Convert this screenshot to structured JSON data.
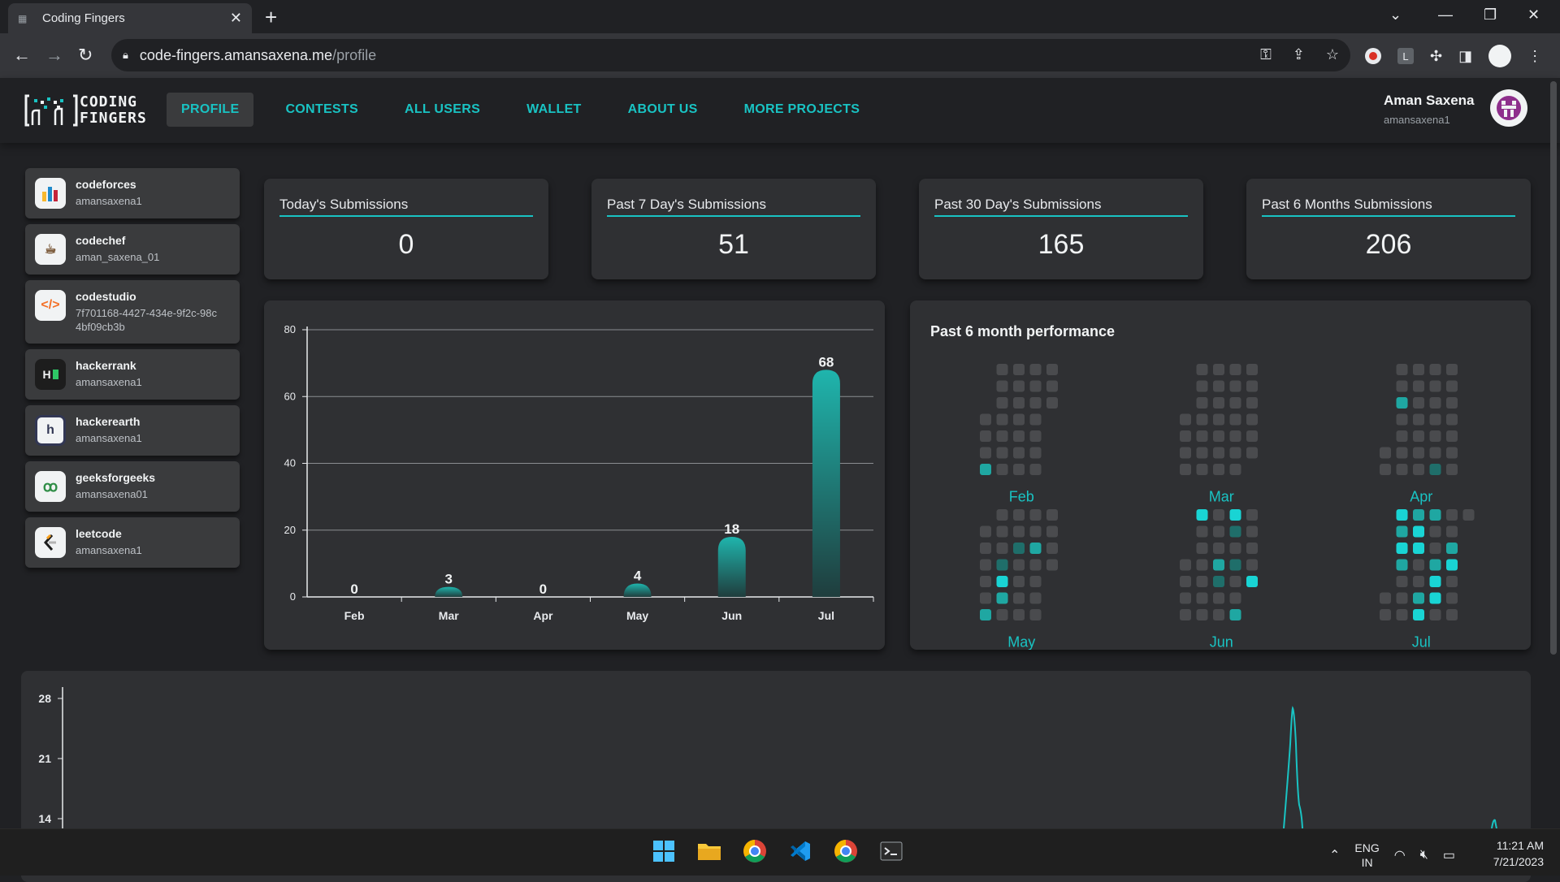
{
  "browser": {
    "tab_title": "Coding Fingers",
    "url_host": "code-fingers.amansaxena.me",
    "url_path": "/profile"
  },
  "site": {
    "logo_line1": "CODING",
    "logo_line2": "FINGERS",
    "nav": [
      "PROFILE",
      "CONTESTS",
      "ALL USERS",
      "WALLET",
      "ABOUT US",
      "MORE PROJECTS"
    ],
    "active_nav": "PROFILE",
    "user_name": "Aman Saxena",
    "user_handle": "amansaxena1"
  },
  "platforms": [
    {
      "name": "codeforces",
      "user": "amansaxena1",
      "icon": "codeforces-icon"
    },
    {
      "name": "codechef",
      "user": "aman_saxena_01",
      "icon": "codechef-icon"
    },
    {
      "name": "codestudio",
      "user": "7f701168-4427-434e-9f2c-98c4bf09cb3b",
      "icon": "codestudio-icon"
    },
    {
      "name": "hackerrank",
      "user": "amansaxena1",
      "icon": "hackerrank-icon"
    },
    {
      "name": "hackerearth",
      "user": "amansaxena1",
      "icon": "hackerearth-icon"
    },
    {
      "name": "geeksforgeeks",
      "user": "amansaxena01",
      "icon": "geeksforgeeks-icon"
    },
    {
      "name": "leetcode",
      "user": "amansaxena1",
      "icon": "leetcode-icon"
    }
  ],
  "stats": [
    {
      "title": "Today's Submissions",
      "value": "0"
    },
    {
      "title": "Past 7 Day's Submissions",
      "value": "51"
    },
    {
      "title": "Past 30 Day's Submissions",
      "value": "165"
    },
    {
      "title": "Past 6 Months Submissions",
      "value": "206"
    }
  ],
  "perf_title": "Past 6 month performance",
  "colors": {
    "accent": "#19c3c3",
    "bar_top": "#1fb5ad",
    "bar_bottom": "#1a3b3b",
    "cell_empty": "#4a4b4e"
  },
  "chart_data": [
    {
      "type": "bar",
      "categories": [
        "Feb",
        "Mar",
        "Apr",
        "May",
        "Jun",
        "Jul"
      ],
      "values": [
        0,
        3,
        0,
        4,
        18,
        68
      ],
      "yticks": [
        0,
        20,
        40,
        60,
        80
      ],
      "ylim": [
        0,
        80
      ],
      "grid": true
    },
    {
      "type": "line",
      "yticks": [
        14,
        21,
        28
      ],
      "ylim": [
        14,
        28
      ]
    }
  ],
  "heatmap_months": [
    {
      "label": "Feb",
      "days": 28,
      "offset": 3,
      "levels": {
        "3": 2
      }
    },
    {
      "label": "Mar",
      "days": 31,
      "offset": 3,
      "levels": {}
    },
    {
      "label": "Apr",
      "days": 30,
      "offset": 5,
      "levels": {
        "4": 2,
        "22": 1
      }
    },
    {
      "label": "May",
      "days": 31,
      "offset": 1,
      "levels": {
        "5": 2,
        "9": 1,
        "10": 3,
        "11": 2,
        "15": 1,
        "22": 2
      }
    },
    {
      "label": "Jun",
      "days": 30,
      "offset": 3,
      "levels": {
        "4": 3,
        "14": 2,
        "15": 1,
        "18": 3,
        "19": 1,
        "21": 1,
        "24": 2,
        "29": 3
      }
    },
    {
      "label": "Jul",
      "days": 31,
      "offset": 5,
      "levels": {
        "2": 3,
        "3": 2,
        "4": 3,
        "5": 2,
        "9": 2,
        "10": 3,
        "11": 3,
        "14": 2,
        "15": 3,
        "16": 2,
        "19": 2,
        "20": 3,
        "21": 3,
        "25": 2,
        "26": 3
      }
    }
  ],
  "taskbar": {
    "lang": "ENG",
    "region": "IN",
    "time": "11:21 AM",
    "date": "7/21/2023"
  }
}
